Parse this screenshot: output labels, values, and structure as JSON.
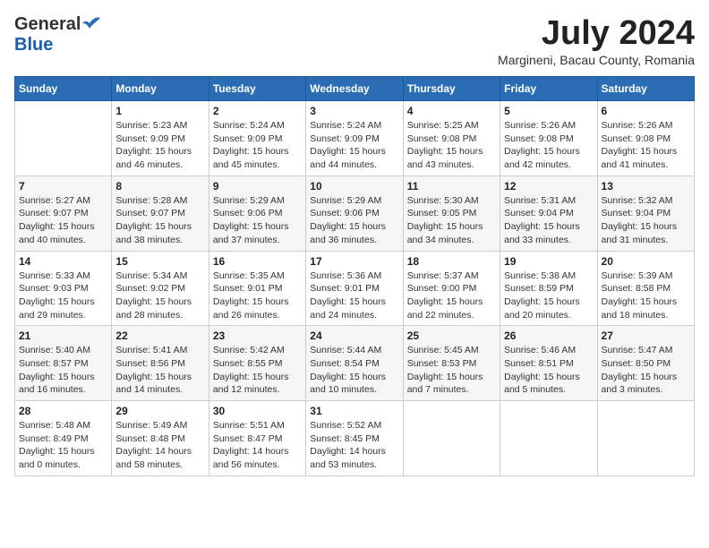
{
  "header": {
    "logo_general": "General",
    "logo_blue": "Blue",
    "month_year": "July 2024",
    "location": "Margineni, Bacau County, Romania"
  },
  "calendar": {
    "weekdays": [
      "Sunday",
      "Monday",
      "Tuesday",
      "Wednesday",
      "Thursday",
      "Friday",
      "Saturday"
    ],
    "weeks": [
      [
        {
          "day": "",
          "info": ""
        },
        {
          "day": "1",
          "info": "Sunrise: 5:23 AM\nSunset: 9:09 PM\nDaylight: 15 hours\nand 46 minutes."
        },
        {
          "day": "2",
          "info": "Sunrise: 5:24 AM\nSunset: 9:09 PM\nDaylight: 15 hours\nand 45 minutes."
        },
        {
          "day": "3",
          "info": "Sunrise: 5:24 AM\nSunset: 9:09 PM\nDaylight: 15 hours\nand 44 minutes."
        },
        {
          "day": "4",
          "info": "Sunrise: 5:25 AM\nSunset: 9:08 PM\nDaylight: 15 hours\nand 43 minutes."
        },
        {
          "day": "5",
          "info": "Sunrise: 5:26 AM\nSunset: 9:08 PM\nDaylight: 15 hours\nand 42 minutes."
        },
        {
          "day": "6",
          "info": "Sunrise: 5:26 AM\nSunset: 9:08 PM\nDaylight: 15 hours\nand 41 minutes."
        }
      ],
      [
        {
          "day": "7",
          "info": "Sunrise: 5:27 AM\nSunset: 9:07 PM\nDaylight: 15 hours\nand 40 minutes."
        },
        {
          "day": "8",
          "info": "Sunrise: 5:28 AM\nSunset: 9:07 PM\nDaylight: 15 hours\nand 38 minutes."
        },
        {
          "day": "9",
          "info": "Sunrise: 5:29 AM\nSunset: 9:06 PM\nDaylight: 15 hours\nand 37 minutes."
        },
        {
          "day": "10",
          "info": "Sunrise: 5:29 AM\nSunset: 9:06 PM\nDaylight: 15 hours\nand 36 minutes."
        },
        {
          "day": "11",
          "info": "Sunrise: 5:30 AM\nSunset: 9:05 PM\nDaylight: 15 hours\nand 34 minutes."
        },
        {
          "day": "12",
          "info": "Sunrise: 5:31 AM\nSunset: 9:04 PM\nDaylight: 15 hours\nand 33 minutes."
        },
        {
          "day": "13",
          "info": "Sunrise: 5:32 AM\nSunset: 9:04 PM\nDaylight: 15 hours\nand 31 minutes."
        }
      ],
      [
        {
          "day": "14",
          "info": "Sunrise: 5:33 AM\nSunset: 9:03 PM\nDaylight: 15 hours\nand 29 minutes."
        },
        {
          "day": "15",
          "info": "Sunrise: 5:34 AM\nSunset: 9:02 PM\nDaylight: 15 hours\nand 28 minutes."
        },
        {
          "day": "16",
          "info": "Sunrise: 5:35 AM\nSunset: 9:01 PM\nDaylight: 15 hours\nand 26 minutes."
        },
        {
          "day": "17",
          "info": "Sunrise: 5:36 AM\nSunset: 9:01 PM\nDaylight: 15 hours\nand 24 minutes."
        },
        {
          "day": "18",
          "info": "Sunrise: 5:37 AM\nSunset: 9:00 PM\nDaylight: 15 hours\nand 22 minutes."
        },
        {
          "day": "19",
          "info": "Sunrise: 5:38 AM\nSunset: 8:59 PM\nDaylight: 15 hours\nand 20 minutes."
        },
        {
          "day": "20",
          "info": "Sunrise: 5:39 AM\nSunset: 8:58 PM\nDaylight: 15 hours\nand 18 minutes."
        }
      ],
      [
        {
          "day": "21",
          "info": "Sunrise: 5:40 AM\nSunset: 8:57 PM\nDaylight: 15 hours\nand 16 minutes."
        },
        {
          "day": "22",
          "info": "Sunrise: 5:41 AM\nSunset: 8:56 PM\nDaylight: 15 hours\nand 14 minutes."
        },
        {
          "day": "23",
          "info": "Sunrise: 5:42 AM\nSunset: 8:55 PM\nDaylight: 15 hours\nand 12 minutes."
        },
        {
          "day": "24",
          "info": "Sunrise: 5:44 AM\nSunset: 8:54 PM\nDaylight: 15 hours\nand 10 minutes."
        },
        {
          "day": "25",
          "info": "Sunrise: 5:45 AM\nSunset: 8:53 PM\nDaylight: 15 hours\nand 7 minutes."
        },
        {
          "day": "26",
          "info": "Sunrise: 5:46 AM\nSunset: 8:51 PM\nDaylight: 15 hours\nand 5 minutes."
        },
        {
          "day": "27",
          "info": "Sunrise: 5:47 AM\nSunset: 8:50 PM\nDaylight: 15 hours\nand 3 minutes."
        }
      ],
      [
        {
          "day": "28",
          "info": "Sunrise: 5:48 AM\nSunset: 8:49 PM\nDaylight: 15 hours\nand 0 minutes."
        },
        {
          "day": "29",
          "info": "Sunrise: 5:49 AM\nSunset: 8:48 PM\nDaylight: 14 hours\nand 58 minutes."
        },
        {
          "day": "30",
          "info": "Sunrise: 5:51 AM\nSunset: 8:47 PM\nDaylight: 14 hours\nand 56 minutes."
        },
        {
          "day": "31",
          "info": "Sunrise: 5:52 AM\nSunset: 8:45 PM\nDaylight: 14 hours\nand 53 minutes."
        },
        {
          "day": "",
          "info": ""
        },
        {
          "day": "",
          "info": ""
        },
        {
          "day": "",
          "info": ""
        }
      ]
    ]
  }
}
